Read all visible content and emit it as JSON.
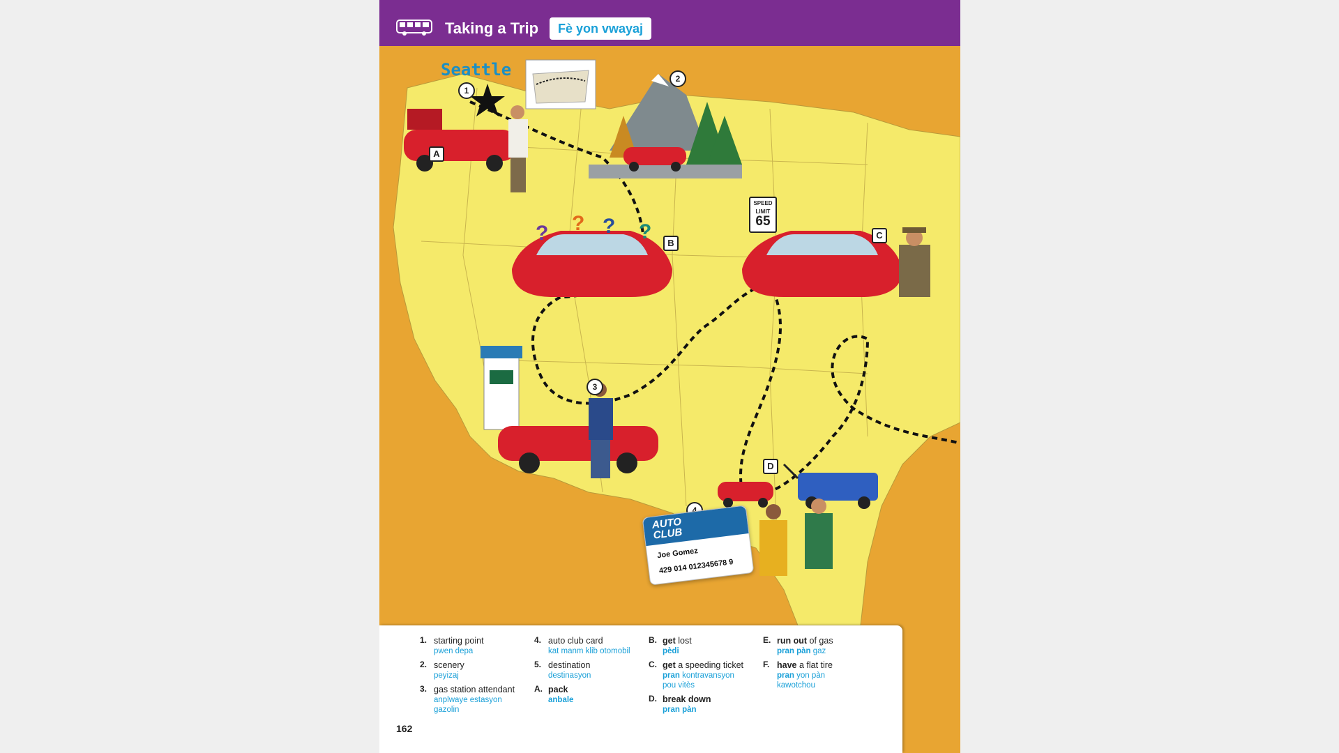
{
  "header": {
    "title": "Taking a Trip",
    "subtitle": "Fè yon vwayaj"
  },
  "map": {
    "city": "Seattle",
    "sign": {
      "line1": "SPEED",
      "line2": "LIMIT",
      "number": "65"
    },
    "card": {
      "brand_line1": "AUTO",
      "brand_line2": "CLUB",
      "name": "Joe Gomez",
      "number": "429  014  012345678  9"
    },
    "markers": [
      "1",
      "2",
      "3",
      "4",
      "A",
      "B",
      "C",
      "D"
    ],
    "question_mark": "?"
  },
  "legend": {
    "items": [
      {
        "key": "1.",
        "en": "starting point",
        "ht": "pwen depa"
      },
      {
        "key": "2.",
        "en": "scenery",
        "ht": "peyizaj"
      },
      {
        "key": "3.",
        "en": "gas station attendant",
        "ht": "anplwaye estasyon gazolin"
      },
      {
        "key": "4.",
        "en": "auto club card",
        "ht": "kat manm klib otomobil"
      },
      {
        "key": "5.",
        "en": "destination",
        "ht": "destinasyon"
      },
      {
        "key": "A.",
        "en_bold": "pack",
        "en_rest": "",
        "ht_bold": "anbale",
        "ht_rest": ""
      },
      {
        "key": "B.",
        "en_bold": "get",
        "en_rest": " lost",
        "ht_bold": "pèdi",
        "ht_rest": ""
      },
      {
        "key": "C.",
        "en_bold": "get",
        "en_rest": " a speeding ticket",
        "ht_bold": "pran",
        "ht_rest": " kontravansyon pou vitès"
      },
      {
        "key": "D.",
        "en_bold": "break down",
        "en_rest": "",
        "ht_bold": "pran pàn",
        "ht_rest": ""
      },
      {
        "key": "E.",
        "en_bold": "run out",
        "en_rest": " of gas",
        "ht_bold": "pran pàn",
        "ht_rest": " gaz"
      },
      {
        "key": "F.",
        "en_bold": "have",
        "en_rest": " a flat tire",
        "ht_bold": "pran",
        "ht_rest": " yon pàn kawotchou"
      }
    ],
    "page_number": "162"
  },
  "colors": {
    "header": "#7b2d91",
    "accent": "#1aa0d8",
    "map_land": "#f5ea6a",
    "ocean": "#e8a532",
    "car": "#d8202c"
  }
}
